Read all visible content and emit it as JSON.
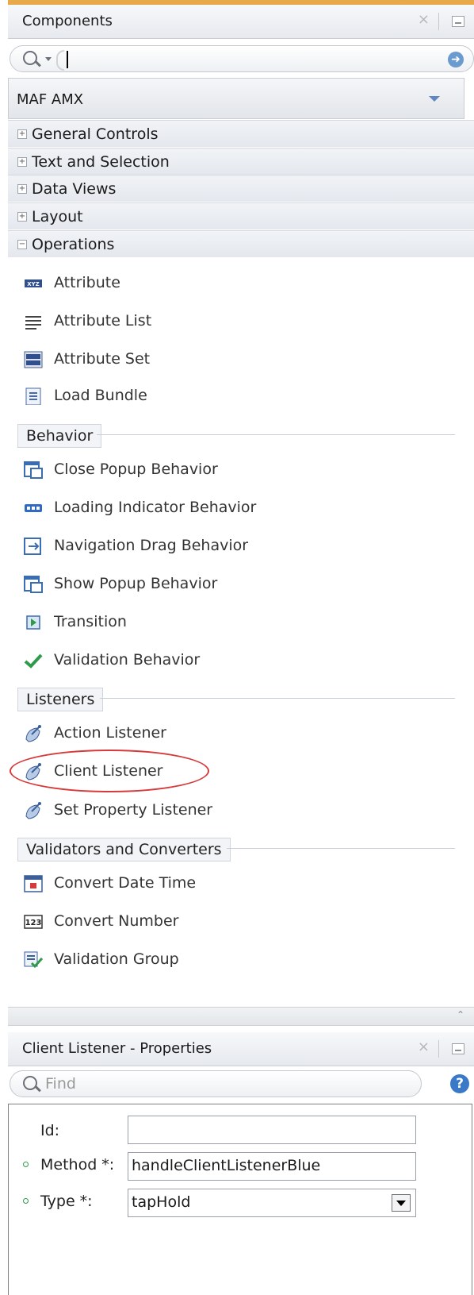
{
  "components_panel": {
    "title": "Components",
    "close_glyph": "×",
    "library_select": "MAF AMX",
    "categories": [
      {
        "label": "General Controls",
        "state": "+"
      },
      {
        "label": "Text and Selection",
        "state": "+"
      },
      {
        "label": "Data Views",
        "state": "+"
      },
      {
        "label": "Layout",
        "state": "+"
      },
      {
        "label": "Operations",
        "state": "−"
      }
    ],
    "operations_items": [
      {
        "label": "Attribute",
        "icon": "attribute-icon"
      },
      {
        "label": "Attribute List",
        "icon": "list-icon"
      },
      {
        "label": "Attribute Set",
        "icon": "attribute-set-icon"
      },
      {
        "label": "Load Bundle",
        "icon": "bundle-icon"
      }
    ],
    "sections": {
      "behavior": "Behavior",
      "listeners": "Listeners",
      "validators": "Validators and Converters"
    },
    "behavior_items": [
      {
        "label": "Close Popup Behavior",
        "icon": "popup-icon"
      },
      {
        "label": "Loading Indicator Behavior",
        "icon": "loading-icon"
      },
      {
        "label": "Navigation Drag Behavior",
        "icon": "drag-icon"
      },
      {
        "label": "Show Popup Behavior",
        "icon": "popup-icon"
      },
      {
        "label": "Transition",
        "icon": "transition-icon"
      },
      {
        "label": "Validation Behavior",
        "icon": "checkmark-icon"
      }
    ],
    "listener_items": [
      {
        "label": "Action Listener",
        "icon": "satellite-icon"
      },
      {
        "label": "Client Listener",
        "icon": "satellite-icon",
        "highlighted": true
      },
      {
        "label": "Set Property Listener",
        "icon": "satellite-icon"
      }
    ],
    "validator_items": [
      {
        "label": "Convert Date Time",
        "icon": "calendar-icon"
      },
      {
        "label": "Convert Number",
        "icon": "number-icon"
      },
      {
        "label": "Validation Group",
        "icon": "validation-group-icon"
      }
    ]
  },
  "properties_panel": {
    "title": "Client Listener - Properties",
    "close_glyph": "×",
    "search_placeholder": "Find",
    "help_glyph": "?",
    "fields": {
      "id_label": "Id:",
      "id_value": "",
      "method_label": "Method *:",
      "method_value": "handleClientListenerBlue",
      "type_label": "Type *:",
      "type_value": "tapHold"
    }
  },
  "colors": {
    "accent": "#e8a94a",
    "highlight_oval": "#d63a3a",
    "required_dot": "#2f9a4a"
  }
}
